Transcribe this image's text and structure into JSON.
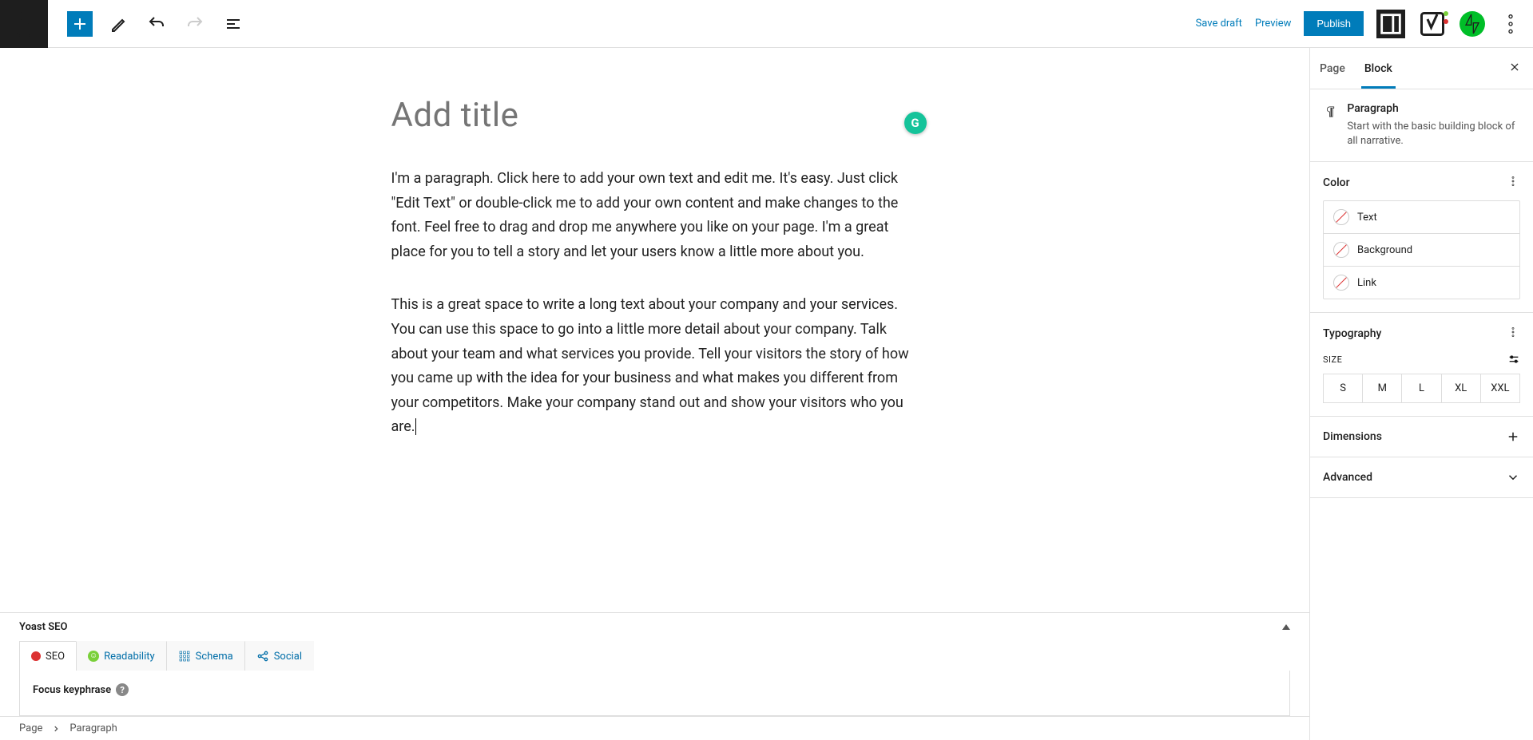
{
  "topbar": {
    "save_draft": "Save draft",
    "preview": "Preview",
    "publish": "Publish"
  },
  "editor": {
    "title_placeholder": "Add title",
    "paragraph1": "I'm a paragraph. Click here to add your own text and edit me. It's easy. Just click \"Edit Text\" or double-click me to add your own content and make changes to the font. Feel free to drag and drop me anywhere you like on your page. I'm a great place for you to tell a story and let your users know a little more about you.",
    "paragraph2": "This is a great space to write a long text about your company and your services. You can use this space to go into a little more detail about your company. Talk about your team and what services you provide. Tell your visitors the story of how you came up with the idea for your business and what makes you different from your competitors. Make your company stand out and show your visitors who you are."
  },
  "yoast": {
    "title": "Yoast SEO",
    "tabs": {
      "seo": "SEO",
      "readability": "Readability",
      "schema": "Schema",
      "social": "Social"
    },
    "focus_label": "Focus keyphrase"
  },
  "breadcrumb": {
    "root": "Page",
    "current": "Paragraph"
  },
  "sidebar": {
    "tabs": {
      "page": "Page",
      "block": "Block"
    },
    "block": {
      "name": "Paragraph",
      "description": "Start with the basic building block of all narrative."
    },
    "panels": {
      "color": {
        "title": "Color",
        "items": {
          "text": "Text",
          "background": "Background",
          "link": "Link"
        }
      },
      "typography": {
        "title": "Typography",
        "size_label": "Size",
        "sizes": {
          "s": "S",
          "m": "M",
          "l": "L",
          "xl": "XL",
          "xxl": "XXL"
        }
      },
      "dimensions": "Dimensions",
      "advanced": "Advanced"
    }
  }
}
